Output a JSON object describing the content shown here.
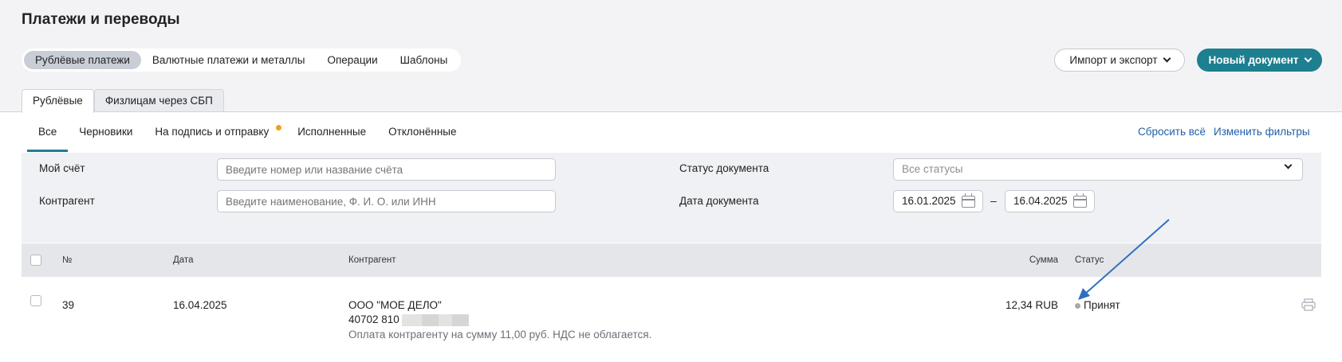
{
  "page": {
    "title": "Платежи и переводы"
  },
  "top_tabs": [
    {
      "label": "Рублёвые платежи",
      "active": true
    },
    {
      "label": "Валютные платежи и металлы",
      "active": false
    },
    {
      "label": "Операции",
      "active": false
    },
    {
      "label": "Шаблоны",
      "active": false
    }
  ],
  "actions": {
    "import_export": "Импорт и экспорт",
    "new_document": "Новый документ"
  },
  "sub_tabs": [
    {
      "label": "Рублёвые",
      "active": true
    },
    {
      "label": "Физлицам через СБП",
      "active": false
    }
  ],
  "status_tabs": [
    {
      "label": "Все",
      "active": true
    },
    {
      "label": "Черновики",
      "active": false
    },
    {
      "label": "На подпись и отправку",
      "active": false,
      "badge": true
    },
    {
      "label": "Исполненные",
      "active": false
    },
    {
      "label": "Отклонённые",
      "active": false
    }
  ],
  "links": {
    "reset": "Сбросить всё",
    "change_filters": "Изменить фильтры"
  },
  "filters": {
    "my_account": {
      "label": "Мой счёт",
      "placeholder": "Введите номер или название счёта"
    },
    "counterparty": {
      "label": "Контрагент",
      "placeholder": "Введите наименование, Ф. И. О. или ИНН"
    },
    "doc_status": {
      "label": "Статус документа",
      "value": "Все статусы"
    },
    "doc_date": {
      "label": "Дата документа",
      "from": "16.01.2025",
      "separator": "–",
      "to": "16.04.2025"
    }
  },
  "table": {
    "columns": {
      "number": "№",
      "date": "Дата",
      "counterparty": "Контрагент",
      "amount": "Сумма",
      "status": "Статус"
    },
    "rows": [
      {
        "number": "39",
        "date": "16.04.2025",
        "counterparty_name": "ООО \"МОЕ ДЕЛО\"",
        "account": "40702 810",
        "purpose": "Оплата контрагенту на сумму 11,00 руб. НДС не облагается.",
        "amount": "12,34 RUB",
        "status": "Принят"
      }
    ]
  },
  "colors": {
    "accent": "#1d7f8f",
    "link": "#1d5fa8",
    "badge": "#f0a020",
    "annotation_arrow": "#2f6fc0"
  }
}
